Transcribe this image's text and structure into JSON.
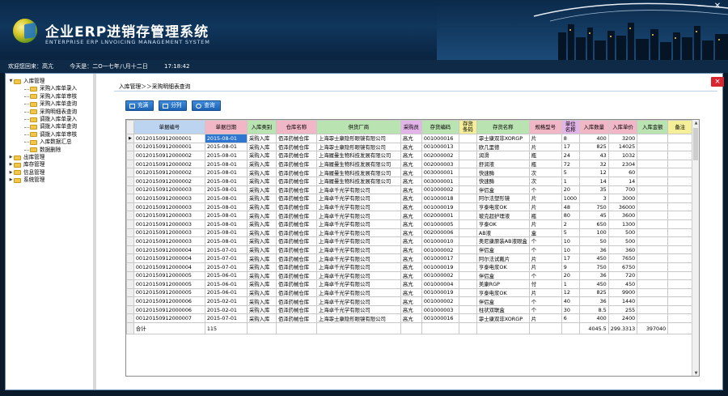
{
  "app": {
    "title_cn": "企业ERP进销存管理系统",
    "title_en": "ENTERPRISE ERP LNVOICING  MANAGEMENT SYSTEM",
    "window_minimize": "—",
    "window_close": "✕"
  },
  "status": {
    "welcome": "欢迎您回来：高亢",
    "date": "今天是：二O一七年八月十二日",
    "time": "17:18:42"
  },
  "tree": {
    "items": [
      {
        "label": "入库管理",
        "level": 0,
        "expander": "▼"
      },
      {
        "label": "采购入库单录入",
        "level": 1
      },
      {
        "label": "采购入库单审核",
        "level": 1
      },
      {
        "label": "采购入库单查询",
        "level": 1
      },
      {
        "label": "采购明细表查询",
        "level": 1
      },
      {
        "label": "调拨入库单录入",
        "level": 1
      },
      {
        "label": "调拨入库单查询",
        "level": 1
      },
      {
        "label": "调拨入库单审核",
        "level": 1
      },
      {
        "label": "入库数据汇总",
        "level": 1
      },
      {
        "label": "数据删除",
        "level": 1
      },
      {
        "label": "出库管理",
        "level": 0,
        "expander": "▶"
      },
      {
        "label": "库存管理",
        "level": 0,
        "expander": "▶"
      },
      {
        "label": "信息管理",
        "level": 0,
        "expander": "▶"
      },
      {
        "label": "系统管理",
        "level": 0,
        "expander": "▶"
      }
    ]
  },
  "content": {
    "breadcrumb": "入库管理＞＞采购明细表查询",
    "close_label": "×",
    "toolbar": {
      "fill_label": "充满",
      "split_label": "分列",
      "query_label": "查询"
    }
  },
  "colors": {
    "blue_header": "#bcd4f0",
    "pink_header": "#f2b7c6",
    "green_header": "#b9e3b0",
    "yellow_header": "#f6ef9a",
    "purple_header": "#e3b4e8",
    "selected_cell": "#2f76d0"
  },
  "grid": {
    "columns": [
      {
        "label": "单据编号",
        "color": "#bcd4f0",
        "w": 88
      },
      {
        "label": "单据日期",
        "color": "#f2b7c6",
        "w": 52
      },
      {
        "label": "入库类别",
        "color": "#b9e3b0",
        "w": 36
      },
      {
        "label": "仓库名称",
        "color": "#f2b7c6",
        "w": 50
      },
      {
        "label": "供货厂商",
        "color": "#b9e3b0",
        "w": 104
      },
      {
        "label": "采购员",
        "color": "#e3b4e8",
        "w": 26
      },
      {
        "label": "存货编码",
        "color": "#b9e3b0",
        "w": 46
      },
      {
        "label": "存货条码",
        "color": "#f6ef9a",
        "w": 22
      },
      {
        "label": "存货名称",
        "color": "#b9e3b0",
        "w": 60
      },
      {
        "label": "规格型号",
        "color": "#f2b7c6",
        "w": 40
      },
      {
        "label": "单位名称",
        "color": "#e3b4e8",
        "w": 22
      },
      {
        "label": "入库数量",
        "color": "#f2b7c6",
        "w": 36
      },
      {
        "label": "入库单价",
        "color": "#f2b7c6",
        "w": 34
      },
      {
        "label": "入库金额",
        "color": "#b9e3b0",
        "w": 38
      },
      {
        "label": "备注",
        "color": "#f6ef9a",
        "w": 30
      }
    ],
    "pointer": "▶",
    "rows": [
      [
        "00120150912000001",
        "2015-08-01",
        "采购入库",
        "佰泽药械仓库",
        "上海霏士康隐形眼镜有限公司",
        "高亢",
        "001000016",
        "",
        "霏士康双非XORGP",
        "片",
        "8",
        "400",
        "3200",
        ""
      ],
      [
        "00120150912000001",
        "2015-08-01",
        "采购入库",
        "佰泽药械仓库",
        "上海霏士康隐形眼镜有限公司",
        "高亢",
        "001000013",
        "",
        "欧几里德",
        "片",
        "17",
        "825",
        "14025",
        ""
      ],
      [
        "00120150912000002",
        "2015-08-01",
        "采购入库",
        "佰泽药械仓库",
        "上海履曼生物科技发展有限公司",
        "高亢",
        "002000002",
        "",
        "润滑",
        "瓶",
        "24",
        "43",
        "1032",
        ""
      ],
      [
        "00120150912000002",
        "2015-08-01",
        "采购入库",
        "佰泽药械仓库",
        "上海履曼生物科技发展有限公司",
        "高亢",
        "002000003",
        "",
        "舒润液",
        "瓶",
        "72",
        "32",
        "2304",
        ""
      ],
      [
        "00120150912000002",
        "2015-08-01",
        "采购入库",
        "佰泽药械仓库",
        "上海履曼生物科技发展有限公司",
        "高亢",
        "003000001",
        "",
        "快速酶",
        "次",
        "5",
        "12",
        "60",
        ""
      ],
      [
        "00120150912000002",
        "2015-08-01",
        "采购入库",
        "佰泽药械仓库",
        "上海履曼生物科技发展有限公司",
        "高亢",
        "003000001",
        "",
        "快速酶",
        "次",
        "1",
        "14",
        "14",
        ""
      ],
      [
        "00120150912000003",
        "2015-08-01",
        "采购入库",
        "佰泽药械仓库",
        "上海卓千光学有限公司",
        "高亢",
        "001000002",
        "",
        "伴侣盒",
        "个",
        "20",
        "35",
        "700",
        ""
      ],
      [
        "00120150912000003",
        "2015-08-01",
        "采购入库",
        "佰泽药械仓库",
        "上海卓千光学有限公司",
        "高亢",
        "001000018",
        "",
        "阿尔法塑形镜",
        "片",
        "1000",
        "3",
        "3000",
        ""
      ],
      [
        "00120150912000003",
        "2015-08-01",
        "采购入库",
        "佰泽药械仓库",
        "上海卓千光学有限公司",
        "高亢",
        "001000019",
        "",
        "亨泰电浆OK",
        "片",
        "48",
        "750",
        "36000",
        ""
      ],
      [
        "00120150912000003",
        "2015-08-01",
        "采购入库",
        "佰泽药械仓库",
        "上海卓千光学有限公司",
        "高亢",
        "002000001",
        "",
        "玻克超护理液",
        "瓶",
        "80",
        "45",
        "3600",
        ""
      ],
      [
        "00120150912000003",
        "2015-08-01",
        "采购入库",
        "佰泽药械仓库",
        "上海卓千光学有限公司",
        "高亢",
        "001000005",
        "",
        "亨泰OK",
        "片",
        "2",
        "650",
        "1300",
        ""
      ],
      [
        "00120150912000003",
        "2015-08-01",
        "采购入库",
        "佰泽药械仓库",
        "上海卓千光学有限公司",
        "高亢",
        "002000006",
        "",
        "AB液",
        "盒",
        "5",
        "100",
        "500",
        ""
      ],
      [
        "00120150912000003",
        "2015-08-01",
        "采购入库",
        "佰泽药械仓库",
        "上海卓千光学有限公司",
        "高亢",
        "001000010",
        "",
        "奥尼康原装AB液眼盒",
        "个",
        "10",
        "50",
        "500",
        ""
      ],
      [
        "00120150912000004",
        "2015-07-01",
        "采购入库",
        "佰泽药械仓库",
        "上海卓千光学有限公司",
        "高亢",
        "001000002",
        "",
        "伴侣盒",
        "个",
        "10",
        "36",
        "360",
        ""
      ],
      [
        "00120150912000004",
        "2015-07-01",
        "采购入库",
        "佰泽药械仓库",
        "上海卓千光学有限公司",
        "高亢",
        "001000017",
        "",
        "阿尔法试戴片",
        "片",
        "17",
        "450",
        "7650",
        ""
      ],
      [
        "00120150912000004",
        "2015-07-01",
        "采购入库",
        "佰泽药械仓库",
        "上海卓千光学有限公司",
        "高亢",
        "001000019",
        "",
        "亨泰电浆OK",
        "片",
        "9",
        "750",
        "6750",
        ""
      ],
      [
        "00120150912000005",
        "2015-06-01",
        "采购入库",
        "佰泽药械仓库",
        "上海卓千光学有限公司",
        "高亢",
        "001000002",
        "",
        "伴侣盒",
        "个",
        "20",
        "36",
        "720",
        ""
      ],
      [
        "00120150912000005",
        "2015-06-01",
        "采购入库",
        "佰泽药械仓库",
        "上海卓千光学有限公司",
        "高亢",
        "001000004",
        "",
        "美康RGP",
        "付",
        "1",
        "450",
        "450",
        ""
      ],
      [
        "00120150912000005",
        "2015-06-01",
        "采购入库",
        "佰泽药械仓库",
        "上海卓千光学有限公司",
        "高亢",
        "001000019",
        "",
        "亨泰电浆OK",
        "片",
        "12",
        "825",
        "9900",
        ""
      ],
      [
        "00120150912000006",
        "2015-02-01",
        "采购入库",
        "佰泽药械仓库",
        "上海卓千光学有限公司",
        "高亢",
        "001000002",
        "",
        "伴侣盒",
        "个",
        "40",
        "36",
        "1440",
        ""
      ],
      [
        "00120150912000006",
        "2015-02-01",
        "采购入库",
        "佰泽药械仓库",
        "上海卓千光学有限公司",
        "高亢",
        "001000003",
        "",
        "柱状双联盒",
        "个",
        "30",
        "8.5",
        "255",
        ""
      ],
      [
        "00120150912000007",
        "2015-07-01",
        "采购入库",
        "佰泽药械仓库",
        "上海霏士康隐形眼镜有限公司",
        "高亢",
        "001000016",
        "",
        "霏士康双非XORGP",
        "片",
        "6",
        "400",
        "2400",
        ""
      ]
    ],
    "total": {
      "label": "合计",
      "count": "115",
      "qty": "4045.5",
      "price": "299.3313",
      "amount": "397040"
    }
  }
}
